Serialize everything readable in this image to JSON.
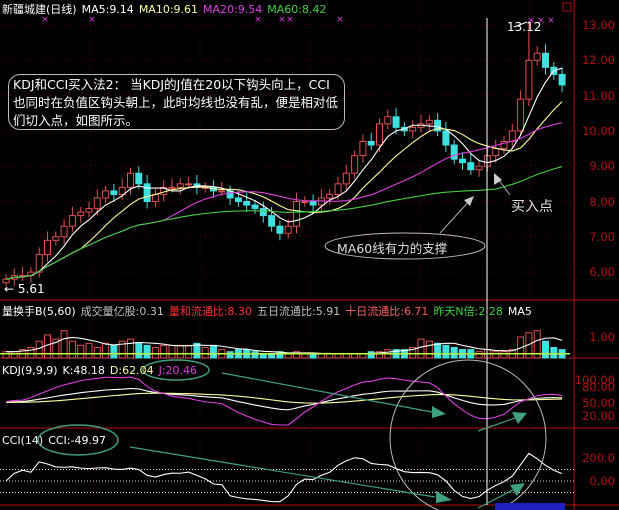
{
  "title": "新疆城建(日线)",
  "ma_header": [
    {
      "label": "MA5:9.14",
      "color": "#ffffff"
    },
    {
      "label": "MA10:9.61",
      "color": "#ffff99"
    },
    {
      "label": "MA20:9.54",
      "color": "#e040e0"
    },
    {
      "label": "MA60:8.42",
      "color": "#40d040"
    }
  ],
  "note": "KDJ和CCI买入法2：  当KDJ的J值在20以下钩头向上，CCI也同时在负值区钩头朝上，此时均线也没有乱，便是相对低们切入点，如图所示。",
  "annotations": {
    "high": "13.12",
    "low": "← 5.61",
    "buy_point": "买入点",
    "ma60_support": "MA60线有力的支撑"
  },
  "volume_header": [
    {
      "label": "量换手B(5,60)",
      "color": "#ffffff"
    },
    {
      "label": "成交量亿股:0.31",
      "color": "#c0c0c0"
    },
    {
      "label": "量和流通比:8.30",
      "color": "#ff3030"
    },
    {
      "label": "五日流通比:5.91",
      "color": "#c0c0c0"
    },
    {
      "label": "十日流通比:6.71",
      "color": "#ff6060"
    },
    {
      "label": "昨天N倍:2.28",
      "color": "#40d040"
    },
    {
      "label": "MA5",
      "color": "#ffffff"
    }
  ],
  "kdj_header": [
    {
      "label": "KDJ(9,9,9)",
      "color": "#ffffff"
    },
    {
      "label": "K:48.18",
      "color": "#ffffff"
    },
    {
      "label": "D:62.04",
      "color": "#ffff99"
    },
    {
      "label": "J:20.46",
      "color": "#e040e0"
    }
  ],
  "cci_header": [
    {
      "label": "CCI(14)",
      "color": "#ffffff"
    },
    {
      "label": "CCI:-49.97",
      "color": "#ffffff"
    }
  ],
  "colors": {
    "up": "#e05050",
    "down": "#40e0e0",
    "axis": "#b01010",
    "grid": "#600000"
  },
  "chart_data": {
    "type": "candlestick",
    "price_axis": {
      "ticks": [
        "13.00",
        "12.00",
        "11.00",
        "10.00",
        "9.00",
        "8.00",
        "7.00",
        "6.00"
      ],
      "range": [
        5.4,
        13.4
      ]
    },
    "volume_axis": {
      "ticks": [
        "1.00"
      ]
    },
    "kdj_axis": {
      "ticks": [
        "100.00",
        "80.00",
        "50.00",
        "20.00"
      ]
    },
    "cci_axis": {
      "ticks": [
        "200.0",
        "0.00"
      ]
    },
    "closes": [
      5.8,
      5.9,
      5.9,
      6.0,
      6.5,
      6.9,
      7.0,
      7.3,
      7.6,
      7.7,
      7.8,
      8.1,
      8.3,
      8.2,
      8.4,
      8.8,
      8.5,
      8.0,
      8.2,
      8.4,
      8.4,
      8.5,
      8.5,
      8.4,
      8.4,
      8.3,
      8.3,
      8.1,
      8.0,
      7.9,
      7.8,
      7.6,
      7.3,
      7.1,
      7.3,
      8.0,
      8.0,
      7.9,
      8.1,
      8.2,
      8.5,
      8.8,
      9.3,
      9.7,
      9.6,
      10.2,
      10.4,
      10.1,
      10.0,
      10.1,
      10.2,
      10.3,
      10.0,
      9.6,
      9.2,
      9.1,
      8.9,
      9.0,
      9.3,
      9.5,
      9.7,
      10.0,
      10.9,
      12.0,
      12.2,
      11.8,
      11.6,
      11.3
    ],
    "volumes": [
      0.3,
      0.3,
      0.4,
      0.5,
      0.8,
      1.1,
      0.9,
      1.3,
      0.8,
      0.6,
      0.7,
      0.5,
      0.7,
      0.6,
      0.8,
      0.9,
      0.7,
      0.6,
      0.5,
      0.6,
      0.6,
      0.6,
      0.6,
      0.7,
      0.5,
      0.6,
      0.4,
      0.3,
      0.4,
      0.4,
      0.3,
      0.2,
      0.2,
      0.3,
      0.2,
      0.3,
      0.2,
      0.2,
      0.2,
      0.2,
      0.2,
      0.2,
      0.2,
      0.2,
      0.3,
      0.3,
      0.4,
      0.4,
      0.4,
      0.5,
      0.9,
      0.8,
      0.7,
      0.6,
      0.5,
      0.4,
      0.4,
      0.3,
      0.4,
      0.3,
      0.3,
      0.4,
      1.0,
      1.2,
      1.3,
      0.8,
      0.5,
      0.4
    ],
    "high_marker": 13.12,
    "low_marker": 5.61
  }
}
